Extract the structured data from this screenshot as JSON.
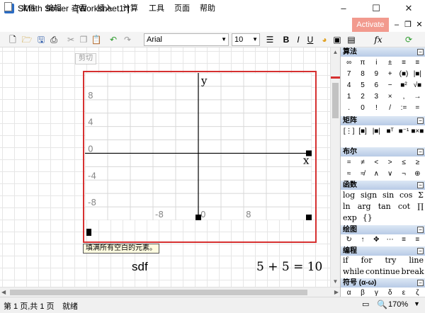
{
  "window": {
    "title": "SMath Solver - [Worksheet1*]",
    "app_icon": "smath-app-icon",
    "controls": [
      "–",
      "☐",
      "✕"
    ]
  },
  "menu": {
    "items": [
      "文件",
      "编辑",
      "查看",
      "插入",
      "计算",
      "工具",
      "页面",
      "帮助"
    ],
    "activate": "Activate",
    "mdi_controls": [
      "–",
      "❐",
      "✕"
    ]
  },
  "toolbar": {
    "font": "Arial",
    "font_size": "10",
    "fx_label": "fx"
  },
  "worksheet": {
    "cut_button": "剪切",
    "tooltip": "填满所有空白的元素。",
    "text_region": "sdf",
    "expression": "5 + 5 = 10"
  },
  "chart_data": {
    "type": "line",
    "title": "",
    "xlabel": "x",
    "ylabel": "y",
    "xlim": [
      -20,
      20
    ],
    "ylim": [
      -10,
      12
    ],
    "x_ticks": [
      -8,
      0,
      8
    ],
    "y_ticks": [
      8,
      4,
      0,
      -4,
      -8
    ],
    "x_tick_labels": [
      "-8",
      "0",
      "8"
    ],
    "y_tick_labels": [
      "8",
      "4",
      "0",
      "-4",
      "-8"
    ],
    "grid": true,
    "series": []
  },
  "panel": {
    "arithmetic": {
      "title": "算法",
      "keys": [
        "∞",
        "π",
        "i",
        "±",
        "≡",
        "≡",
        "7",
        "8",
        "9",
        "+",
        "(■)",
        "|■|",
        "4",
        "5",
        "6",
        "−",
        "■²",
        "√■",
        "1",
        "2",
        "3",
        "×",
        ",",
        "→",
        ".",
        "0",
        "!",
        "/",
        ":=",
        "="
      ]
    },
    "matrix": {
      "title": "矩阵",
      "keys": [
        "[⋮]",
        "[■]",
        "|■|",
        "■ᵀ",
        "■⁻¹",
        "■×■"
      ]
    },
    "boolean": {
      "title": "布尔",
      "keys": [
        "=",
        "≠",
        "<",
        ">",
        "≤",
        "≥",
        "≈",
        "≉",
        "∧",
        "∨",
        "¬",
        "⊕"
      ]
    },
    "functions": {
      "title": "函数",
      "row1": [
        "log",
        "sign",
        "sin",
        "cos",
        "Σ"
      ],
      "row2": [
        "ln",
        "arg",
        "tan",
        "cot",
        "∏"
      ],
      "row3": [
        "exp",
        "{}"
      ]
    },
    "plot": {
      "title": "绘图",
      "keys": [
        "↻",
        "↑",
        "✥",
        "⋯",
        "≡",
        "≡"
      ]
    },
    "programming": {
      "title": "编程",
      "row1": [
        "if",
        "for",
        "try",
        "line"
      ],
      "row2": [
        "while",
        "continue",
        "break"
      ]
    },
    "symbols": {
      "title": "符号 (α-ω)",
      "keys": [
        "α",
        "β",
        "γ",
        "δ",
        "ε",
        "ζ"
      ]
    }
  },
  "status": {
    "page": "第 1 页,共 1 页",
    "state": "就绪",
    "zoom": "170%"
  }
}
